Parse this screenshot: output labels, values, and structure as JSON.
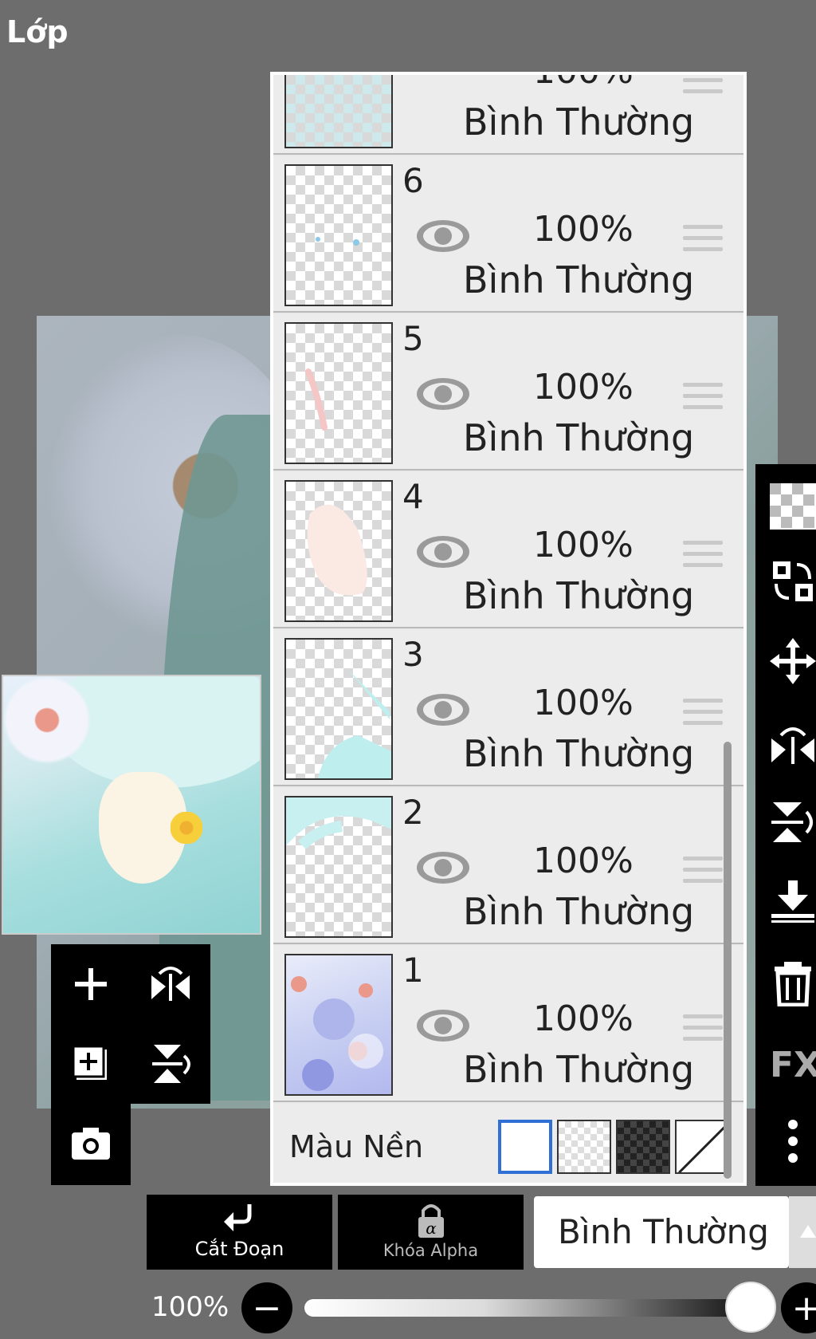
{
  "header": {
    "title": "Lớp"
  },
  "layers": [
    {
      "number": "",
      "opacity": "100%",
      "mode": "Bình Thường"
    },
    {
      "number": "6",
      "opacity": "100%",
      "mode": "Bình Thường"
    },
    {
      "number": "5",
      "opacity": "100%",
      "mode": "Bình Thường"
    },
    {
      "number": "4",
      "opacity": "100%",
      "mode": "Bình Thường"
    },
    {
      "number": "3",
      "opacity": "100%",
      "mode": "Bình Thường"
    },
    {
      "number": "2",
      "opacity": "100%",
      "mode": "Bình Thường"
    },
    {
      "number": "1",
      "opacity": "100%",
      "mode": "Bình Thường"
    }
  ],
  "background": {
    "label": "Màu Nền",
    "options": [
      "white",
      "transparent-light",
      "transparent-dark",
      "none"
    ],
    "selected": "white",
    "selected_color": "#2f6fd6"
  },
  "right_toolbar": {
    "icons": [
      "checker-icon",
      "swap-layer-icon",
      "move-icon",
      "flip-horizontal-icon",
      "flip-vertical-icon",
      "merge-down-icon",
      "trash-icon",
      "fx-icon",
      "more-icon"
    ],
    "fx_label": "FX"
  },
  "left_tools": {
    "icons": [
      "add-layer-icon",
      "flip-horizontal-icon",
      "add-copy-layer-icon",
      "flip-vertical-icon",
      "camera-icon"
    ]
  },
  "bottom": {
    "clip_label": "Cắt Đoạn",
    "alpha_label": "Khóa Alpha",
    "blend_mode": "Bình Thường",
    "opacity_label": "100%",
    "opacity_value": 1.0,
    "minus": "−",
    "plus": "+"
  }
}
